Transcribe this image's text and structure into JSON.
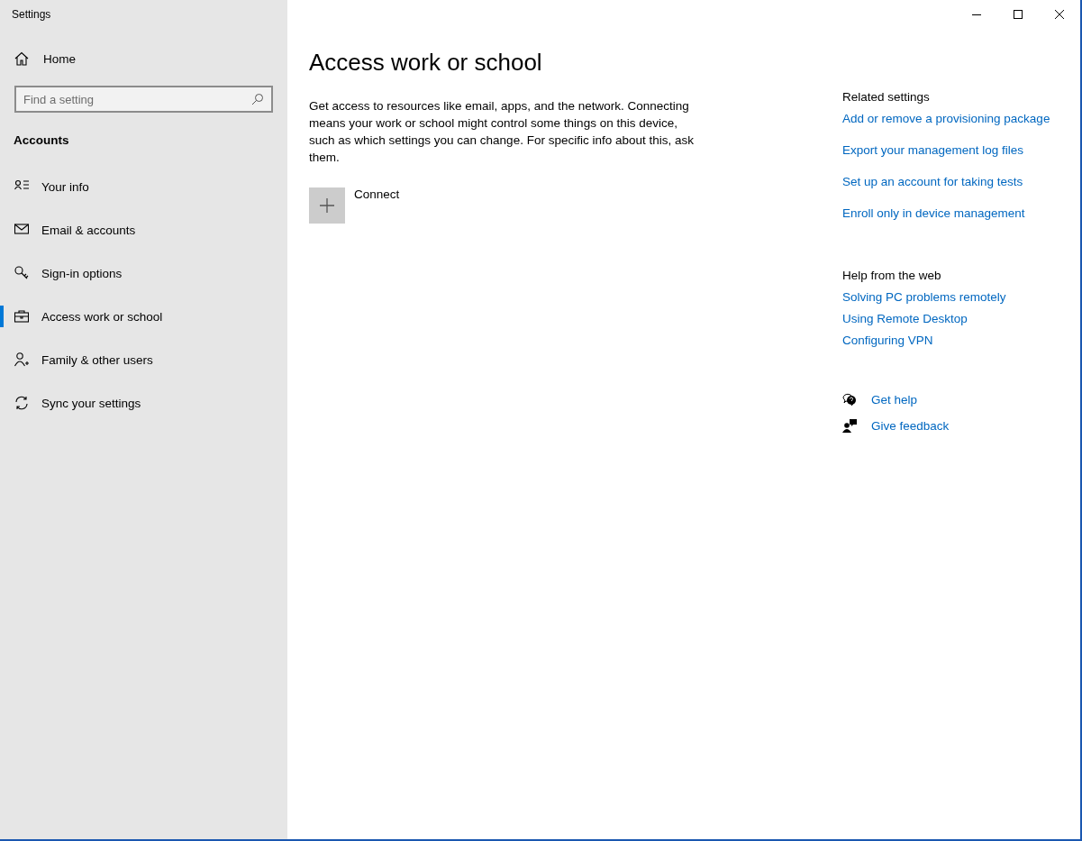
{
  "window": {
    "title": "Settings"
  },
  "sidebar": {
    "home": "Home",
    "search": {
      "placeholder": "Find a setting"
    },
    "section": "Accounts",
    "items": [
      {
        "label": "Your info",
        "selected": false
      },
      {
        "label": "Email & accounts",
        "selected": false
      },
      {
        "label": "Sign-in options",
        "selected": false
      },
      {
        "label": "Access work or school",
        "selected": true
      },
      {
        "label": "Family & other users",
        "selected": false
      },
      {
        "label": "Sync your settings",
        "selected": false
      }
    ]
  },
  "page": {
    "title": "Access work or school",
    "description": "Get access to resources like email, apps, and the network. Connecting means your work or school might control some things on this device, such as which settings you can change. For specific info about this, ask them.",
    "connect": "Connect"
  },
  "related": {
    "heading": "Related settings",
    "links": [
      "Add or remove a provisioning package",
      "Export your management log files",
      "Set up an account for taking tests",
      "Enroll only in device management"
    ]
  },
  "help": {
    "heading": "Help from the web",
    "links": [
      "Solving PC problems remotely",
      "Using Remote Desktop",
      "Configuring VPN"
    ]
  },
  "support": [
    {
      "kind": "help",
      "label": "Get help"
    },
    {
      "kind": "feedback",
      "label": "Give feedback"
    }
  ]
}
